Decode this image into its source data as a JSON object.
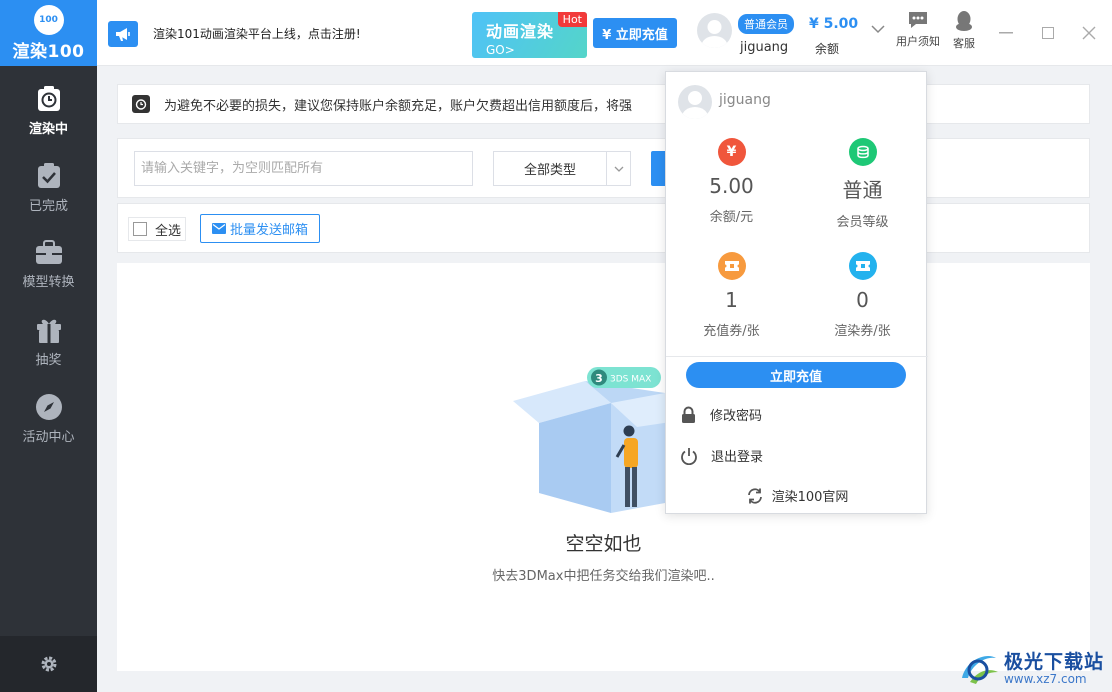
{
  "app": {
    "logo_badge": "100",
    "logo_text": "渲染100"
  },
  "sidebar": {
    "items": [
      {
        "label": "渲染中",
        "icon": "clock-icon",
        "active": true
      },
      {
        "label": "已完成",
        "icon": "clipboard-check-icon",
        "active": false
      },
      {
        "label": "模型转换",
        "icon": "briefcase-icon",
        "active": false
      },
      {
        "label": "抽奖",
        "icon": "gift-icon",
        "active": false
      },
      {
        "label": "活动中心",
        "icon": "compass-icon",
        "active": false
      }
    ],
    "bottom_icon": "gear-icon"
  },
  "topbar": {
    "announcement": "渲染101动画渲染平台上线，点击注册!",
    "banner_title": "动画渲染",
    "banner_go": "GO>",
    "banner_hot": "Hot",
    "recharge_label": "¥ 立即充值",
    "member_badge": "普通会员",
    "username": "jiguang",
    "balance": "¥ 5.00",
    "balance_label": "余额",
    "user_notice": "用户须知",
    "service": "客服"
  },
  "notice": {
    "text": "为避免不必要的损失，建议您保持账户余额充足，账户欠费超出信用额度后，将强"
  },
  "search": {
    "placeholder": "请输入关键字，为空则匹配所有",
    "type_value": "全部类型"
  },
  "actions": {
    "select_all": "全选",
    "batch_email": "批量发送邮箱"
  },
  "empty": {
    "badge_num": "3",
    "badge_text": "3DS MAX",
    "title": "空空如也",
    "desc": "快去3DMax中把任务交给我们渲染吧.."
  },
  "dropdown": {
    "username": "jiguang",
    "stats": [
      {
        "value": "5.00",
        "label": "余额/元",
        "icon": "yen-icon",
        "color": "#f0563c",
        "glyph": "¥"
      },
      {
        "value": "普通",
        "label": "会员等级",
        "icon": "coins-icon",
        "color": "#1ec876",
        "glyph": "≡"
      },
      {
        "value": "1",
        "label": "充值券/张",
        "icon": "ticket-icon",
        "color": "#f79a3e",
        "glyph": "▣"
      },
      {
        "value": "0",
        "label": "渲染券/张",
        "icon": "ticket-icon",
        "color": "#23b2ee",
        "glyph": "▣"
      }
    ],
    "recharge": "立即充值",
    "change_password": "修改密码",
    "logout": "退出登录",
    "official_site": "渲染100官网"
  },
  "watermark": {
    "title": "极光下载站",
    "url": "www.xz7.com"
  }
}
